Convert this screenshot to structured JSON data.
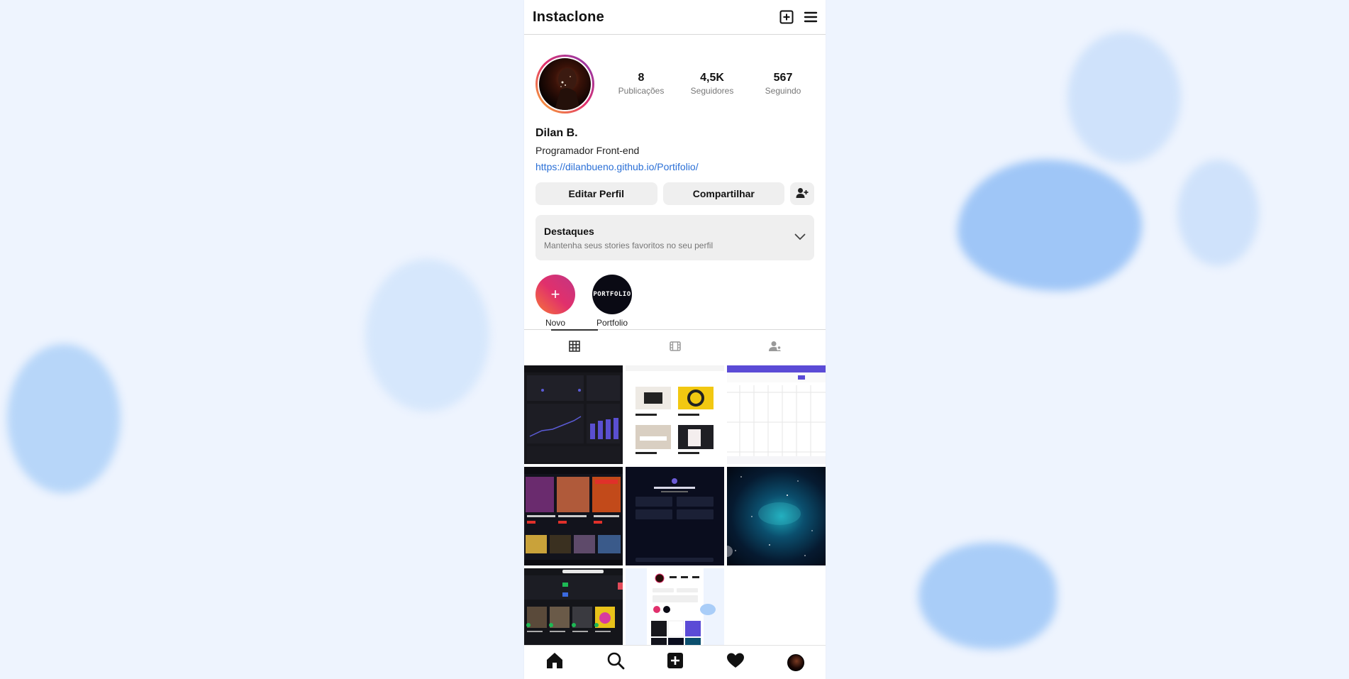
{
  "app": {
    "title": "Instaclone"
  },
  "profile": {
    "name": "Dilan B.",
    "bio": "Programador Front-end",
    "link": "https://dilanbueno.github.io/Portifolio/",
    "stats": [
      {
        "value": "8",
        "label": "Publicações"
      },
      {
        "value": "4,5K",
        "label": "Seguidores"
      },
      {
        "value": "567",
        "label": "Seguindo"
      }
    ]
  },
  "actions": {
    "edit": "Editar Perfil",
    "share": "Compartilhar"
  },
  "highlights": {
    "title": "Destaques",
    "subtitle": "Mantenha seus stories favoritos no seu perfil"
  },
  "stories": [
    {
      "label": "Novo",
      "glyph": "+"
    },
    {
      "label": "Portfolio",
      "glyph": "PORTFOLIO"
    }
  ],
  "tabs": [
    "grid-icon",
    "reels-icon",
    "tagged-icon"
  ],
  "posts": [
    {
      "theme": "dashboard-dark"
    },
    {
      "theme": "shop-products"
    },
    {
      "theme": "calendar-app"
    },
    {
      "theme": "movies-streaming"
    },
    {
      "theme": "chat-dark"
    },
    {
      "theme": "space-nebula"
    },
    {
      "theme": "music-player"
    },
    {
      "theme": "profile-clone"
    }
  ],
  "nav": [
    "home-icon",
    "search-icon",
    "add-post-icon",
    "heart-icon",
    "profile-avatar"
  ],
  "colors": {
    "link": "#2a6fd6",
    "background": "#eef4fe",
    "accent_gradient_start": "#f77737",
    "accent_gradient_end": "#c13584"
  }
}
